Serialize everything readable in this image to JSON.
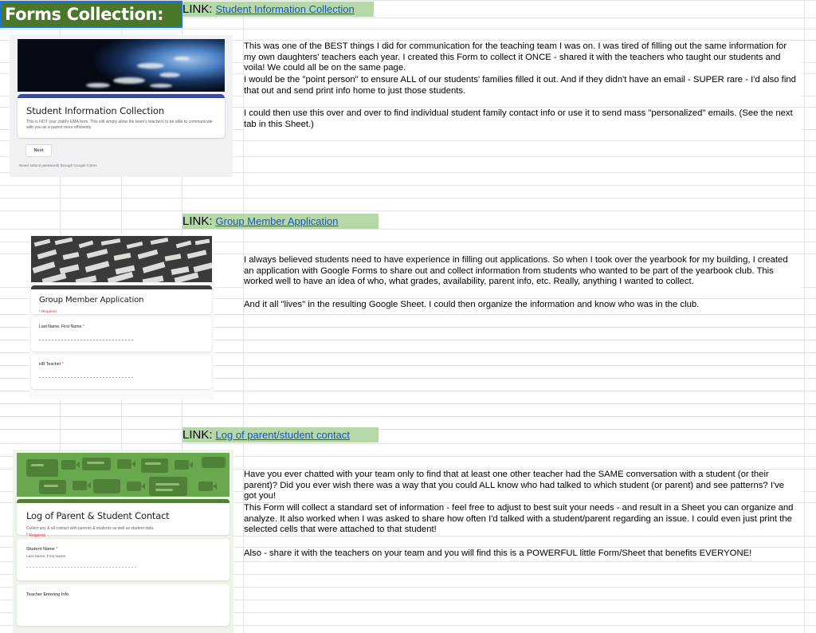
{
  "header": {
    "title": "Forms Collection:"
  },
  "link_label": "LINK:",
  "sections": [
    {
      "link_text": "Student Information Collection",
      "form": {
        "title": "Student Information Collection",
        "description": "This is NOT your child's EMA form. This will simply allow the team's teachers to be able to communicate with you as a parent more efficiently.",
        "button": "Next",
        "footnote": "Never submit passwords through Google Forms."
      },
      "paragraphs": [
        "This was one of the BEST things I did for communication for the teaching team I was on. I was tired of filling out the same information for my own daughters' teachers each year. I created this Form to collect it ONCE - shared it with the teachers who taught our students and voila! We could all be on the same page.",
        "I would be the \"point person\" to ensure ALL of our students' families filled it out. And if they didn't have an email - SUPER rare - I'd also find that out and send print info home to just those students.",
        "I could then use this over and over to find individual student family contact info or use it to send mass \"personalized\" emails. (See the next tab in this Sheet.)"
      ]
    },
    {
      "link_text": "Group Member Application",
      "form": {
        "title": "Group Member Application",
        "required_note": "* Required",
        "questions": [
          {
            "label": "Last Name, First Name ",
            "required_mark": "*"
          },
          {
            "label": "HR Teacher ",
            "required_mark": "*"
          }
        ]
      },
      "paragraphs": [
        "I always believed students need to have experience in filling out applications. So when I took over the yearbook for my building, I created an application with Google Forms to share out and collect information from students who wanted to be part of the yearbook club. This worked well to have an idea of who, what grades, availability, parent info, etc. Really, anything I wanted to collect.",
        "And it all \"lives\" in the resulting Google Sheet. I could then organize the information and know who was in the club."
      ]
    },
    {
      "link_text": "Log of parent/student contact",
      "form": {
        "title": "Log of Parent & Student Contact",
        "description": "Collect any & all contact with parents & students as well as student data.",
        "required_note": "* Required",
        "questions": [
          {
            "label": "Student Name ",
            "required_mark": "*",
            "sublabel": "Last Name, First Name"
          },
          {
            "label": "Teacher Entering Info",
            "required_mark": "",
            "sublabel": ""
          }
        ]
      },
      "paragraphs": [
        "Have you ever chatted with your team only to find that at least one other teacher had the SAME conversation with a student (or their parent)? Did you ever wish there was a way that you could ALL know who had talked to which student (or parent) and see patterns? I've got you!",
        "This Form will collect a standard set of information - feel free to adjust to best suit your needs - and result in a Sheet you can organize and analyze. It also worked when I was asked to share how often I'd talked with a student/parent regarding an issue. I could even just print the selected cells that were attached to that student!",
        "Also - share it with the teachers on your team and you will find this is a POWERFUL little Form/Sheet that benefits EVERYONE!"
      ]
    }
  ],
  "colors": {
    "header_green": "#4a7729",
    "link_green": "#b6d7a8",
    "link_blue": "#1155cc",
    "selection_blue": "#1a73e8",
    "gridline": "#e2e3e3"
  }
}
